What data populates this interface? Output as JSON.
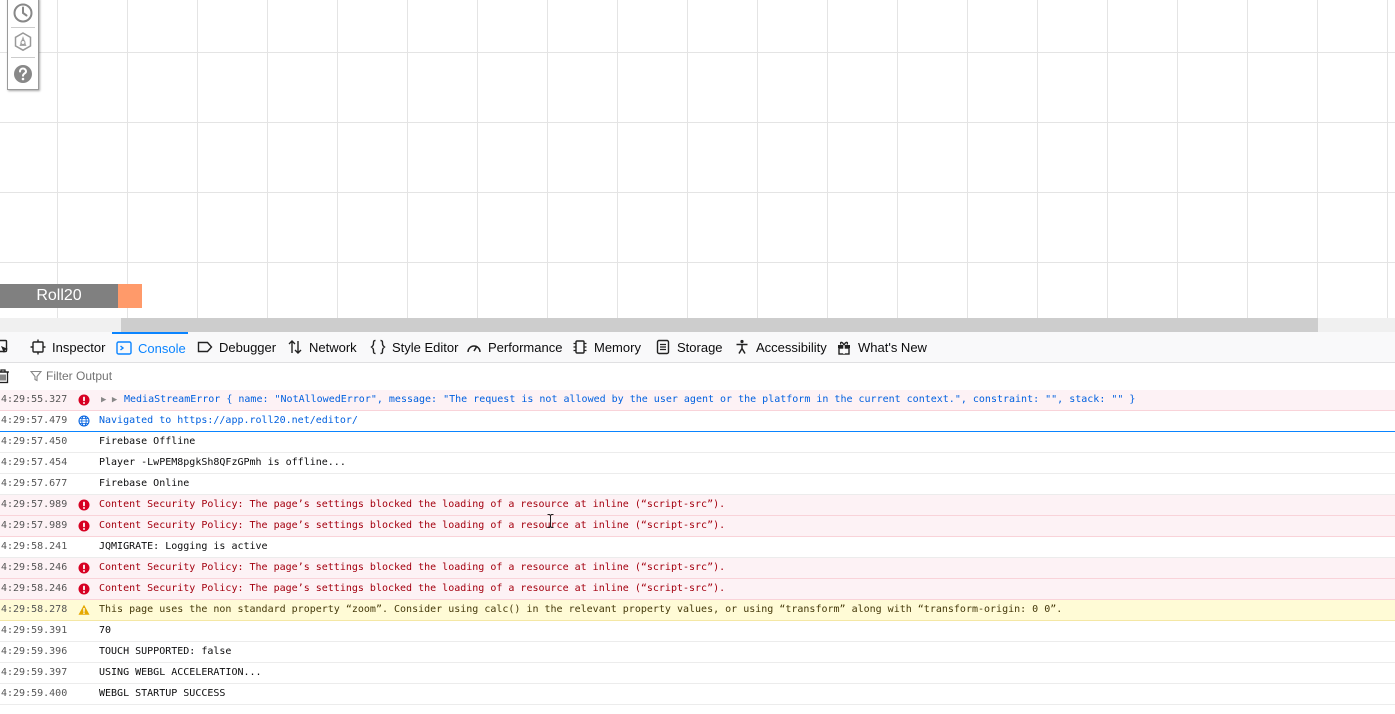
{
  "canvas": {
    "toolbar_icons": [
      "clock-icon",
      "compass-icon",
      "help-icon"
    ],
    "roll20_tab_label": "Roll20",
    "accent_color": "#ff9a6a"
  },
  "devtools": {
    "tabs": [
      {
        "label": "Inspector",
        "icon": "inspector-icon",
        "active": false
      },
      {
        "label": "Console",
        "icon": "console-icon",
        "active": true
      },
      {
        "label": "Debugger",
        "icon": "debugger-icon",
        "active": false
      },
      {
        "label": "Network",
        "icon": "network-icon",
        "active": false
      },
      {
        "label": "Style Editor",
        "icon": "style-editor-icon",
        "active": false
      },
      {
        "label": "Performance",
        "icon": "performance-icon",
        "active": false
      },
      {
        "label": "Memory",
        "icon": "memory-icon",
        "active": false
      },
      {
        "label": "Storage",
        "icon": "storage-icon",
        "active": false
      },
      {
        "label": "Accessibility",
        "icon": "accessibility-icon",
        "active": false
      },
      {
        "label": "What's New",
        "icon": "gift-icon",
        "active": false
      }
    ],
    "filter": {
      "placeholder": "Filter Output",
      "value": ""
    },
    "log": [
      {
        "time": "4:29:55.327",
        "level": "error",
        "object": true,
        "text": "MediaStreamError { name: \"NotAllowedError\", message: \"The request is not allowed by the user agent or the platform in the current context.\", constraint: \"\", stack: \"\" }"
      },
      {
        "time": "4:29:57.479",
        "level": "nav",
        "text": "Navigated to https://app.roll20.net/editor/"
      },
      {
        "time": "4:29:57.450",
        "level": "log",
        "text": "Firebase Offline"
      },
      {
        "time": "4:29:57.454",
        "level": "log",
        "text": "Player -LwPEM8pgkSh8QFzGPmh is offline..."
      },
      {
        "time": "4:29:57.677",
        "level": "log",
        "text": "Firebase Online"
      },
      {
        "time": "4:29:57.989",
        "level": "error",
        "text": "Content Security Policy: The page’s settings blocked the loading of a resource at inline (“script-src”)."
      },
      {
        "time": "4:29:57.989",
        "level": "error",
        "text": "Content Security Policy: The page’s settings blocked the loading of a resource at inline (“script-src”)."
      },
      {
        "time": "4:29:58.241",
        "level": "log",
        "text": "JQMIGRATE: Logging is active"
      },
      {
        "time": "4:29:58.246",
        "level": "error",
        "text": "Content Security Policy: The page’s settings blocked the loading of a resource at inline (“script-src”)."
      },
      {
        "time": "4:29:58.246",
        "level": "error",
        "text": "Content Security Policy: The page’s settings blocked the loading of a resource at inline (“script-src”)."
      },
      {
        "time": "4:29:58.278",
        "level": "warn",
        "text": "This page uses the non standard property “zoom”. Consider using calc() in the relevant property values, or using “transform” along with “transform-origin: 0 0”."
      },
      {
        "time": "4:29:59.391",
        "level": "log",
        "text": "70"
      },
      {
        "time": "4:29:59.396",
        "level": "log",
        "text": "TOUCH SUPPORTED: false"
      },
      {
        "time": "4:29:59.397",
        "level": "log",
        "text": "USING WEBGL ACCELERATION..."
      },
      {
        "time": "4:29:59.400",
        "level": "log",
        "text": "WEBGL STARTUP SUCCESS"
      }
    ]
  }
}
